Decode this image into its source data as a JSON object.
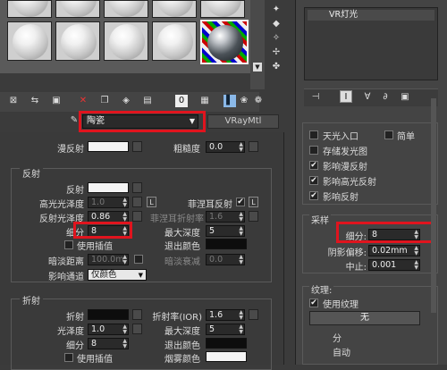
{
  "slots": [
    {
      "id": "s1"
    },
    {
      "id": "s2"
    },
    {
      "id": "s3"
    },
    {
      "id": "s4"
    },
    {
      "id": "s5"
    },
    {
      "id": "s6"
    },
    {
      "id": "s7"
    },
    {
      "id": "s8"
    },
    {
      "id": "s9"
    },
    {
      "id": "s10"
    },
    {
      "id": "s11"
    }
  ],
  "toolbar_icons": [
    "get-material-icon",
    "put-to-scene-icon",
    "assign-icon",
    "delete-icon",
    "copy-icon",
    "unique-icon",
    "put-library-icon",
    "effects-channel-icon",
    "show-map-icon",
    "show-end-result-icon",
    "go-parent-icon",
    "go-sibling-icon"
  ],
  "material": {
    "name": "陶瓷",
    "type": "VRayMtl",
    "diffuse_label": "漫反射",
    "roughness_label": "粗糙度",
    "roughness_value": "0.0"
  },
  "reflection": {
    "title": "反射",
    "reflect_label": "反射",
    "hilight_gloss_label": "高光光泽度",
    "hilight_gloss_value": "1.0",
    "hilight_lock": "L",
    "fresnel_label": "菲涅耳反射",
    "fresnel_lock": "L",
    "refl_gloss_label": "反射光泽度",
    "refl_gloss_value": "0.86",
    "fresnel_ior_label": "菲涅耳折射率",
    "fresnel_ior_value": "1.6",
    "subdivs_label": "细分",
    "subdivs_value": "8",
    "max_depth_label": "最大深度",
    "max_depth_value": "5",
    "use_interp_label": "使用插值",
    "exit_color_label": "退出颜色",
    "dim_distance_label": "暗淡距离",
    "dim_distance_value": "100.0m",
    "dim_falloff_label": "暗淡衰减",
    "dim_falloff_value": "0.0",
    "affect_channels_label": "影响通道",
    "affect_channels_value": "仅颜色"
  },
  "refraction": {
    "title": "折射",
    "refract_label": "折射",
    "ior_label": "折射率(IOR)",
    "ior_value": "1.6",
    "gloss_label": "光泽度",
    "gloss_value": "1.0",
    "max_depth_label": "最大深度",
    "max_depth_value": "5",
    "subdivs_label": "细分",
    "subdivs_value": "8",
    "exit_color_label": "退出颜色",
    "use_interp_label": "使用插值",
    "fog_color_label": "烟雾颜色"
  },
  "light": {
    "name": "VR灯光"
  },
  "options": {
    "no_decay_label": "天光入口",
    "simple_label": "简单",
    "store_irradiance_label": "存储发光图",
    "affect_diffuse_label": "影响漫反射",
    "affect_specular_label": "影响高光反射",
    "affect_reflections_label": "影响反射"
  },
  "sampling": {
    "title": "采样",
    "subdivs_label": "细分:",
    "subdivs_value": "8",
    "shadow_bias_label": "阴影偏移:",
    "shadow_bias_value": "0.02mm",
    "cutoff_label": "中止:",
    "cutoff_value": "0.001"
  },
  "texture": {
    "title": "纹理:",
    "use_texture_label": "使用纹理",
    "none_button": "无",
    "partial_1": "分",
    "partial_2": "自动"
  }
}
